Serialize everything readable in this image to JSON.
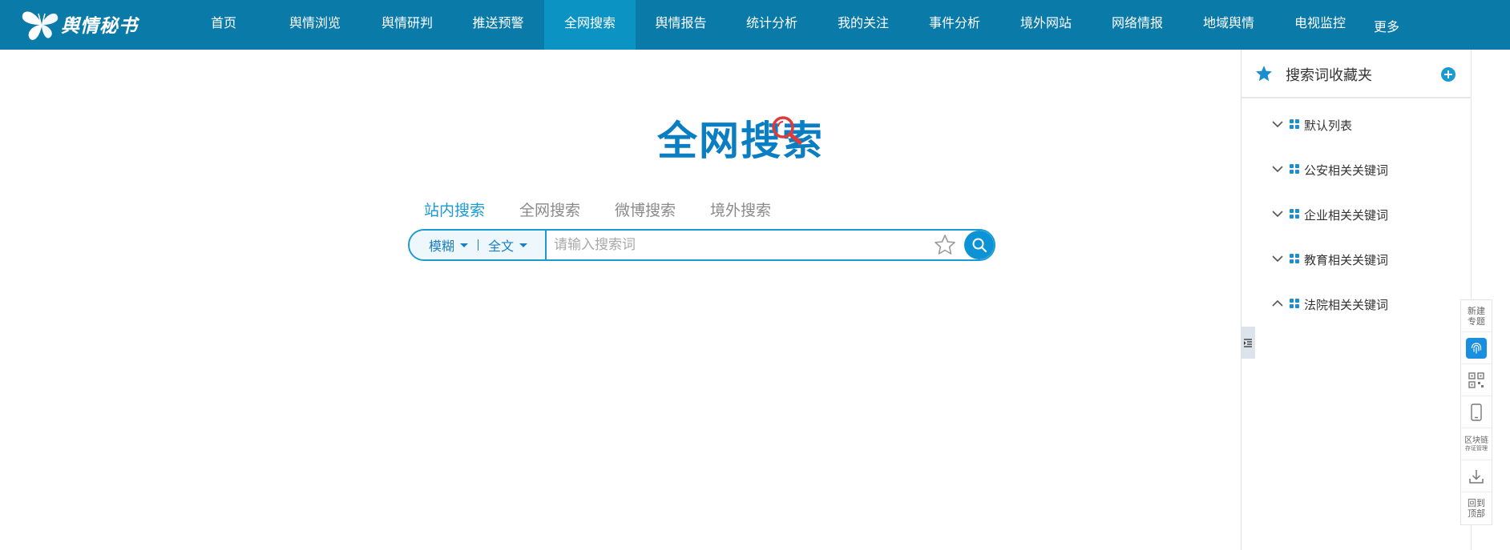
{
  "app": {
    "logo_text": "舆情秘书"
  },
  "nav": {
    "items": [
      {
        "label": "首页",
        "active": false
      },
      {
        "label": "舆情浏览",
        "active": false
      },
      {
        "label": "舆情研判",
        "active": false
      },
      {
        "label": "推送预警",
        "active": false
      },
      {
        "label": "全网搜索",
        "active": true
      },
      {
        "label": "舆情报告",
        "active": false
      },
      {
        "label": "统计分析",
        "active": false
      },
      {
        "label": "我的关注",
        "active": false
      },
      {
        "label": "事件分析",
        "active": false
      },
      {
        "label": "境外网站",
        "active": false
      },
      {
        "label": "网络情报",
        "active": false
      },
      {
        "label": "地域舆情",
        "active": false
      },
      {
        "label": "电视监控",
        "active": false
      }
    ],
    "more_label": "更多",
    "active_color": "#0b93c4",
    "bar_color": "#0a7aa8"
  },
  "hero": {
    "title": "全网搜索"
  },
  "search": {
    "tabs": [
      {
        "label": "站内搜索",
        "active": true
      },
      {
        "label": "全网搜索",
        "active": false
      },
      {
        "label": "微博搜索",
        "active": false
      },
      {
        "label": "境外搜索",
        "active": false
      }
    ],
    "match_mode": "模糊",
    "scope": "全文",
    "placeholder": "请输入搜索词",
    "value": "",
    "accent_color": "#1a9ad2"
  },
  "favorites": {
    "title": "搜索词收藏夹",
    "items": [
      {
        "label": "默认列表",
        "expanded": false
      },
      {
        "label": "公安相关关键词",
        "expanded": false
      },
      {
        "label": "企业相关关键词",
        "expanded": false
      },
      {
        "label": "教育相关关键词",
        "expanded": false
      },
      {
        "label": "法院相关关键词",
        "expanded": true
      }
    ]
  },
  "toolbar": {
    "new_topic_line1": "新建",
    "new_topic_line2": "专题",
    "blockchain_line1": "区块链",
    "blockchain_line2": "存证管理",
    "back_top_line1": "回到",
    "back_top_line2": "顶部"
  }
}
